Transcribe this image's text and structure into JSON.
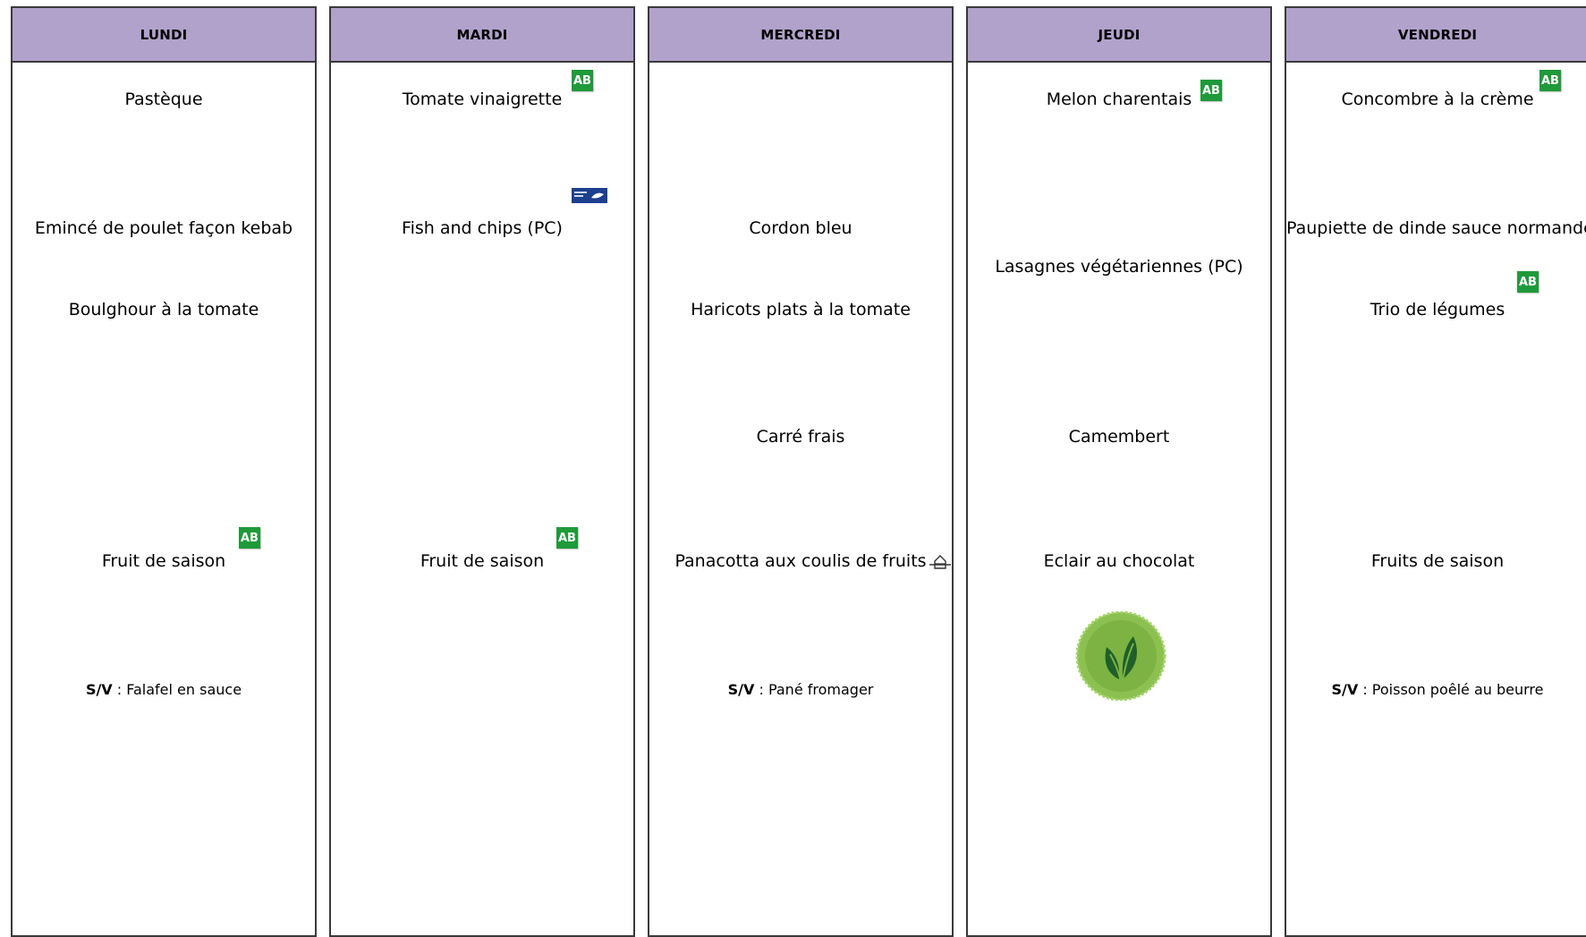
{
  "days": [
    {
      "name": "LUNDI",
      "starter": "Pastèque",
      "main": "Emincé de poulet façon kebab",
      "side": "Boulghour à la tomate",
      "cheese": "",
      "dessert": "Fruit de saison",
      "sv_label": "S/V",
      "sv_text": "Falafel en sauce"
    },
    {
      "name": "MARDI",
      "starter": "Tomate vinaigrette",
      "main": "Fish and chips (PC)",
      "side": "",
      "cheese": "",
      "dessert": "Fruit de saison",
      "sv_label": "",
      "sv_text": ""
    },
    {
      "name": "MERCREDI",
      "starter": "",
      "main": "Cordon bleu",
      "side": "Haricots plats à la tomate",
      "cheese": "Carré frais",
      "dessert": "Panacotta aux coulis de fruits",
      "sv_label": "S/V",
      "sv_text": "Pané fromager"
    },
    {
      "name": "JEUDI",
      "starter": "Melon charentais",
      "main": "Lasagnes végétariennes (PC)",
      "side": "",
      "cheese": "Camembert",
      "dessert": "Eclair au chocolat",
      "sv_label": "",
      "sv_text": ""
    },
    {
      "name": "VENDREDI",
      "starter": "Concombre à la crème",
      "main": "Paupiette de dinde sauce normande",
      "side": "Trio de légumes",
      "cheese": "",
      "dessert": "Fruits de saison",
      "sv_label": "S/V",
      "sv_text": "Poisson poêlé au beurre"
    }
  ],
  "badges": {
    "organic_label": "AB",
    "organic_color": "#1f9a3a",
    "msc_icon": "msc-sustainable-fish-icon",
    "vegetarian_icon": "vegetarian-leaf-seal-icon",
    "homemade_icon": "homemade-chef-hat-icon"
  },
  "colors": {
    "header_bg": "#b0a2cb",
    "border": "#3a3a3a"
  }
}
